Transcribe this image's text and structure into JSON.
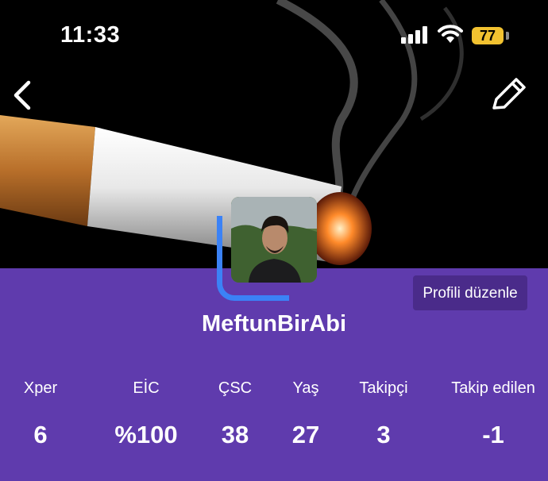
{
  "status_bar": {
    "time": "11:33",
    "battery": "77"
  },
  "profile": {
    "username": "MeftunBirAbi",
    "edit_profile_label": "Profili düzenle"
  },
  "stats": [
    {
      "label": "Xper",
      "value": "6"
    },
    {
      "label": "EİC",
      "value": "%100"
    },
    {
      "label": "ÇSC",
      "value": "38"
    },
    {
      "label": "Yaş",
      "value": "27"
    },
    {
      "label": "Takipçi",
      "value": "3"
    },
    {
      "label": "Takip edilen",
      "value": "-1"
    }
  ],
  "colors": {
    "panel": "#5f3bad",
    "button": "#4a2b8a",
    "ring": "#3b82f6",
    "battery": "#f2c230"
  }
}
